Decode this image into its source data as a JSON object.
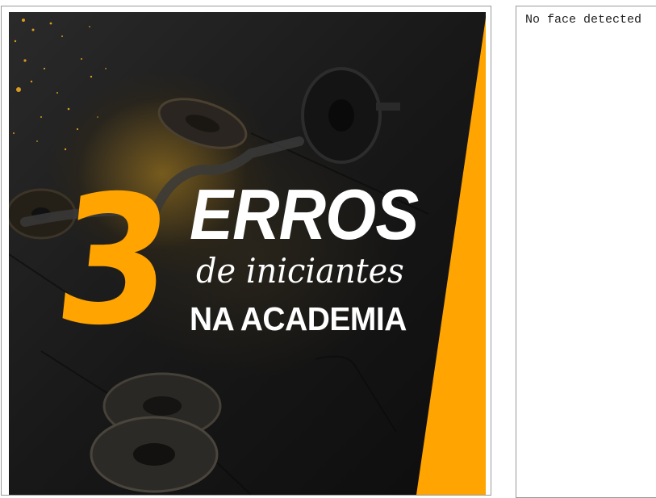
{
  "image": {
    "number": "3",
    "title": "ERROS",
    "subtitle": "de iniciantes",
    "tagline": "NA ACADEMIA",
    "accent_color": "#FFA400",
    "background_color": "#151515",
    "text_color": "#ffffff"
  },
  "detection": {
    "status_text": "No face detected"
  }
}
